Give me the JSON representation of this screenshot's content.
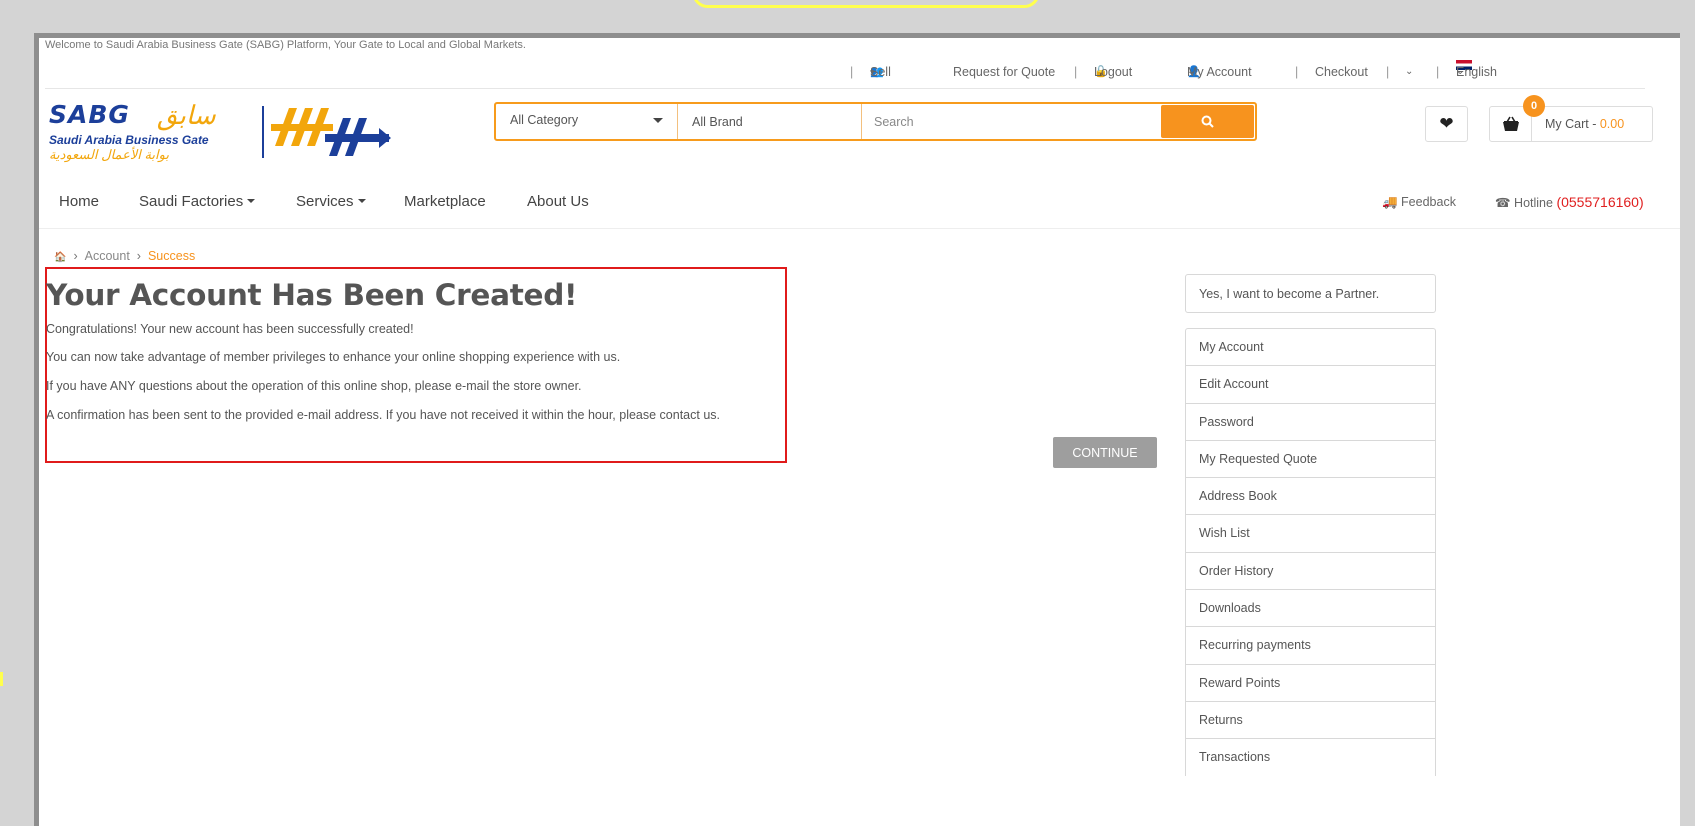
{
  "welcome_text": "Welcome to Saudi Arabia Business Gate (SABG) Platform, Your Gate to Local and Global Markets.",
  "topbar": {
    "sell": "Sell",
    "request_quote": "Request for Quote",
    "logout": "Logout",
    "my_account": "My Account",
    "checkout": "Checkout",
    "language": "English"
  },
  "logo": {
    "latin": "SABG",
    "arabic": "سابق",
    "english_line": "Saudi Arabia Business Gate",
    "arabic_line": "بوابة الأعمال السعودية"
  },
  "search": {
    "category": "All Category",
    "brand": "All Brand",
    "placeholder": "Search"
  },
  "cart": {
    "count": "0",
    "label": "My Cart - ",
    "amount": "0.00"
  },
  "nav": {
    "home": "Home",
    "saudi_factories": "Saudi Factories",
    "services": "Services",
    "marketplace": "Marketplace",
    "about": "About Us",
    "feedback": "Feedback",
    "hotline_label": "Hotline ",
    "hotline_number": "(0555716160)"
  },
  "breadcrumb": {
    "account": "Account",
    "current": "Success"
  },
  "content": {
    "heading": "Your Account Has Been Created!",
    "p1": "Congratulations! Your new account has been successfully created!",
    "p2": "You can now take advantage of member privileges to enhance your online shopping experience with us.",
    "p3": "If you have ANY questions about the operation of this online shop, please e-mail the store owner.",
    "p4": "A confirmation has been sent to the provided e-mail address. If you have not received it within the hour, please contact us."
  },
  "continue_label": "CONTINUE",
  "partner_label": "Yes, I want to become a Partner.",
  "sidebar": {
    "items": [
      {
        "label": "My Account"
      },
      {
        "label": "Edit Account"
      },
      {
        "label": "Password"
      },
      {
        "label": "My Requested Quote"
      },
      {
        "label": "Address Book"
      },
      {
        "label": "Wish List"
      },
      {
        "label": "Order History"
      },
      {
        "label": "Downloads"
      },
      {
        "label": "Recurring payments"
      },
      {
        "label": "Reward Points"
      },
      {
        "label": "Returns"
      },
      {
        "label": "Transactions"
      }
    ]
  },
  "colors": {
    "accent": "#f7931e",
    "brand_blue": "#1c3f9a",
    "highlight": "#e01b1b"
  }
}
